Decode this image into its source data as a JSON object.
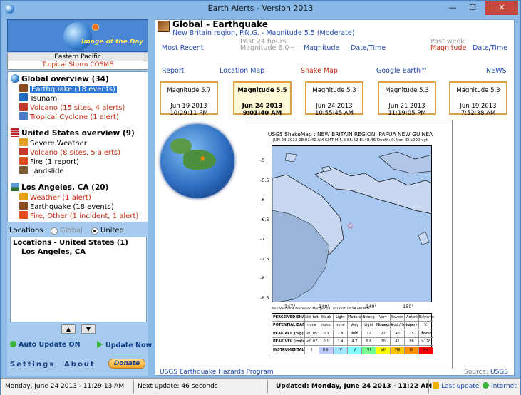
{
  "window": {
    "title": "Earth Alerts - Version 2013"
  },
  "image_of_day": {
    "label": "Image of the Day",
    "region": "Eastern Pacific",
    "caption": "Tropical Storm COSME"
  },
  "tree": {
    "groups": [
      {
        "title": "Global overview (34)",
        "icon": "globe-icon",
        "items": [
          {
            "label": "Earthquake (18 events)",
            "icon": "earthquake-icon",
            "color": "#000000",
            "selected": true
          },
          {
            "label": "Tsunami",
            "icon": "tsunami-icon",
            "color": "#000000"
          },
          {
            "label": "Volcano (15 sites, 4 alerts)",
            "icon": "volcano-icon",
            "color": "#c52a0e"
          },
          {
            "label": "Tropical Cyclone (1 alert)",
            "icon": "cyclone-icon",
            "color": "#c52a0e"
          }
        ]
      },
      {
        "title": "United States overview (9)",
        "icon": "us-flag-icon",
        "items": [
          {
            "label": "Severe Weather",
            "icon": "weather-icon",
            "color": "#000000"
          },
          {
            "label": "Volcano (8 sites, 5 alerts)",
            "icon": "volcano-icon",
            "color": "#c52a0e"
          },
          {
            "label": "Fire (1 report)",
            "icon": "fire-icon",
            "color": "#000000"
          },
          {
            "label": "Landslide",
            "icon": "landslide-icon",
            "color": "#000000"
          }
        ]
      },
      {
        "title": "Los Angeles, CA (20)",
        "icon": "city-icon",
        "items": [
          {
            "label": "Weather (1 alert)",
            "icon": "weather-icon",
            "color": "#c52a0e"
          },
          {
            "label": "Earthquake (18 events)",
            "icon": "earthquake-icon",
            "color": "#000000"
          },
          {
            "label": "Fire, Other (1 incident, 1 alert)",
            "icon": "fire-icon",
            "color": "#c52a0e"
          }
        ]
      }
    ]
  },
  "locations": {
    "label": "Locations",
    "radio_global": "Global",
    "radio_us": "United States",
    "selected": "United States",
    "list_title": "Locations - United States (1)",
    "list_items": [
      "Los Angeles, CA"
    ]
  },
  "controls": {
    "auto_update": "Auto Update ON",
    "update_now": "Update Now",
    "settings": "Settings",
    "about": "About",
    "donate": "Donate"
  },
  "detail": {
    "title": "Global - Earthquake",
    "subtitle": "New Britain region, P.N.G. - Magnitude 5.5 (Moderate)",
    "most_recent": "Most Recent",
    "past24": "Past 24 hours",
    "past24_filter": "Magnitude 6.0+",
    "magnitude": "Magnitude",
    "datetime": "Date/Time",
    "past_week": "Past week",
    "week_magnitude": "Magnitude",
    "week_datetime": "Date/Time",
    "links": [
      "Report",
      "Location Map",
      "Shake Map",
      "Google Earth™",
      "NEWS"
    ],
    "cards": [
      {
        "mag": "Magnitude 5.7",
        "date": "Jun 19 2013",
        "time": "10:29:11 PM",
        "selected": false
      },
      {
        "mag": "Magnitude 5.5",
        "date": "Jun 24 2013",
        "time": "9:01:40 AM",
        "selected": true
      },
      {
        "mag": "Magnitude 5.3",
        "date": "Jun 24 2013",
        "time": "10:55:45 AM",
        "selected": false
      },
      {
        "mag": "Magnitude 5.3",
        "date": "Jun 21 2013",
        "time": "11:19:05 PM",
        "selected": false
      },
      {
        "mag": "Magnitude 5.3",
        "date": "Jun 19 2013",
        "time": "7:52:38 AM",
        "selected": false
      }
    ],
    "shakemap": {
      "title": "USGS ShakeMap : NEW BRITAIN REGION, PAPUA NEW GUINEA",
      "subtitle": "JUN 24 2013 08:01:40 AM GMT   M 5.5   S5.52 E148.46   Depth: 9.6km   ID:c000hlyt",
      "yticks": [
        "-5",
        "-5.5",
        "-6",
        "-6.5",
        "-7",
        "-7.5",
        "-8",
        "-8.5"
      ],
      "xticks": [
        "147°",
        "148°",
        "149°",
        "150°"
      ],
      "note": "Map Version 4 Processed Mon Jun 24, 2013 04:14:58 AM MDT",
      "legend_rows": [
        {
          "label": "PERCEIVED SHAKING",
          "values": [
            "Not felt",
            "Weak",
            "Light",
            "Moderate",
            "Strong",
            "Very strong",
            "Severe",
            "Violent",
            "Extreme"
          ]
        },
        {
          "label": "POTENTIAL DAMAGE",
          "values": [
            "none",
            "none",
            "none",
            "Very light",
            "Light",
            "Moderate",
            "Mod./Heavy",
            "Heavy",
            "V. Heavy"
          ]
        },
        {
          "label": "PEAK ACC.(%g)",
          "values": [
            "<0.05",
            "0.3",
            "2.8",
            "6.2",
            "12",
            "22",
            "40",
            "75",
            ">139"
          ]
        },
        {
          "label": "PEAK VEL.(cm/s)",
          "values": [
            "<0.02",
            "0.1",
            "1.4",
            "4.7",
            "9.6",
            "20",
            "41",
            "86",
            ">178"
          ]
        },
        {
          "label": "INSTRUMENTAL INTENSITY",
          "values": [
            "I",
            "II-III",
            "IV",
            "V",
            "VI",
            "VII",
            "VIII",
            "IX",
            "X+"
          ]
        }
      ],
      "intensity_colors": [
        "#ffffff",
        "#bfccff",
        "#a0e6ff",
        "#80ffff",
        "#7aff93",
        "#ffff00",
        "#ffc800",
        "#ff9100",
        "#ff0000"
      ]
    },
    "footer_link": "USGS Earthquake Hazards Program",
    "source_label": "Source:",
    "source_value": "USGS"
  },
  "status": {
    "datetime": "Monday, June 24 2013 - 11:29:13 AM",
    "next_update": "Next update: 46 seconds",
    "updated": "Updated: Monday, June 24 2013 - 11:22 AM",
    "last_update": "Last update",
    "internet": "Internet"
  }
}
